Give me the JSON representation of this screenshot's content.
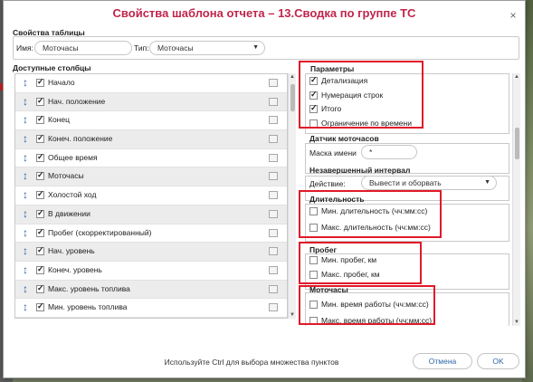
{
  "dialog": {
    "title": "Свойства шаблона отчета – 13.Сводка по группе ТС",
    "close_label": "×"
  },
  "table_properties": {
    "section_label": "Свойства таблицы",
    "name_label": "Имя:",
    "name_value": "Моточасы",
    "type_label": "Тип:",
    "type_value": "Моточасы"
  },
  "columns": {
    "section_label": "Доступные столбцы",
    "items": [
      {
        "label": "Начало",
        "checked": true
      },
      {
        "label": "Нач. положение",
        "checked": true
      },
      {
        "label": "Конец",
        "checked": true
      },
      {
        "label": "Конеч. положение",
        "checked": true
      },
      {
        "label": "Общее время",
        "checked": true
      },
      {
        "label": "Моточасы",
        "checked": true
      },
      {
        "label": "Холостой ход",
        "checked": true
      },
      {
        "label": "В движении",
        "checked": true
      },
      {
        "label": "Пробег (скорректированный)",
        "checked": true
      },
      {
        "label": "Нач. уровень",
        "checked": true
      },
      {
        "label": "Конеч. уровень",
        "checked": true
      },
      {
        "label": "Макс. уровень топлива",
        "checked": true
      },
      {
        "label": "Мин. уровень топлива",
        "checked": true
      }
    ]
  },
  "parameters": {
    "title": "Параметры",
    "options": [
      {
        "label": "Детализация",
        "checked": true
      },
      {
        "label": "Нумерация строк",
        "checked": true
      },
      {
        "label": "Итого",
        "checked": true
      },
      {
        "label": "Ограничение по времени",
        "checked": false
      }
    ]
  },
  "sensor": {
    "title": "Датчик моточасов",
    "mask_label": "Маска имени",
    "mask_value": "*"
  },
  "incomplete": {
    "title": "Незавершенный интервал",
    "action_label": "Действие:",
    "action_value": "Вывести и оборвать"
  },
  "duration": {
    "title": "Длительность",
    "options": [
      {
        "label": "Мин. длительность (чч:мм:сс)",
        "checked": false
      },
      {
        "label": "Макс. длительность (чч:мм:сс)",
        "checked": false
      }
    ]
  },
  "mileage": {
    "title": "Пробег",
    "options": [
      {
        "label": "Мин. пробег, км",
        "checked": false
      },
      {
        "label": "Макс. пробег, км",
        "checked": false
      }
    ]
  },
  "engine_hours": {
    "title": "Моточасы",
    "options": [
      {
        "label": "Мин. время работы (чч:мм:сс)",
        "checked": false
      },
      {
        "label": "Макс. время работы (чч:мм:сс)",
        "checked": false
      }
    ]
  },
  "footer": {
    "hint": "Используйте Ctrl для выбора множества пунктов",
    "cancel_label": "Отмена",
    "ok_label": "OK"
  },
  "icons": {
    "move": "up-down-arrow-icon",
    "edit": "edit-icon",
    "dropdown": "chevron-down-icon"
  },
  "colors": {
    "title": "#c0254c",
    "accent": "#2d67a5",
    "highlight_box": "#e01a2a"
  }
}
